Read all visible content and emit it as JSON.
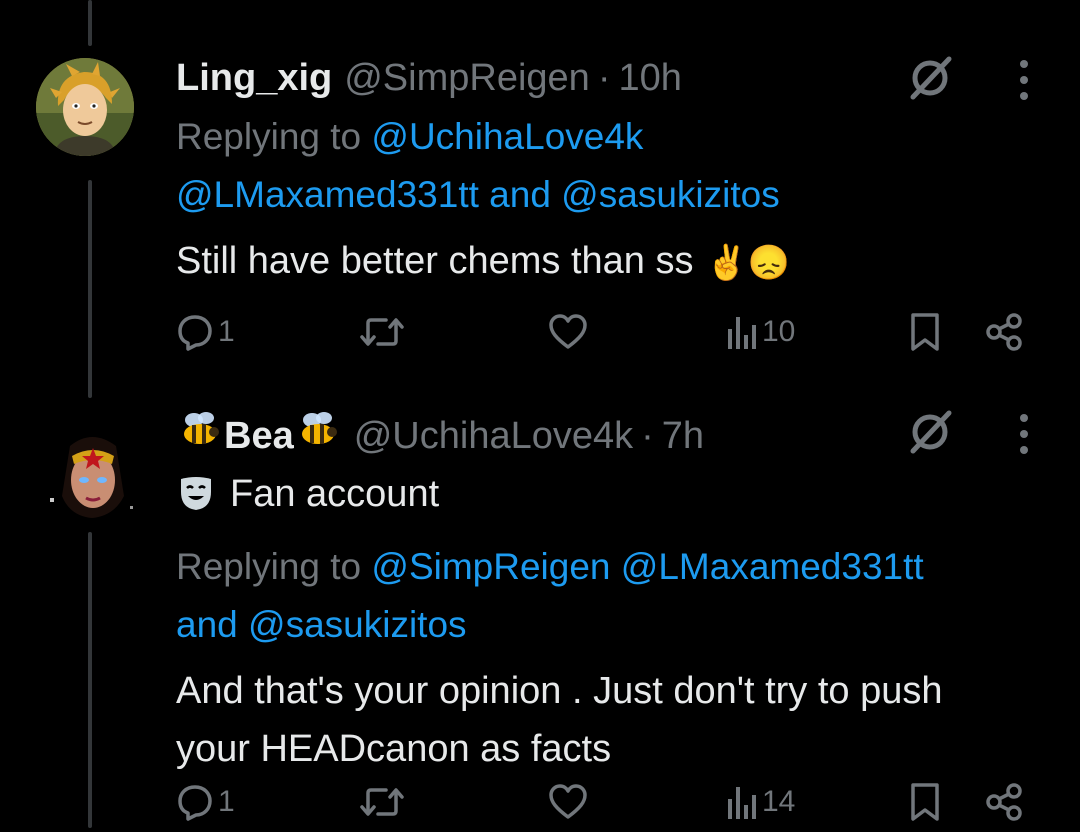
{
  "tweets": [
    {
      "display_name": "Ling_xig",
      "handle": "@SimpReigen",
      "time": "10h",
      "separator": "·",
      "replying_prefix": "Replying to",
      "replying_handles_line1": "@UchihaLove4k",
      "replying_line2": "@LMaxamed331tt and @sasukizitos",
      "body": "Still have better chems than ss",
      "emojis": "✌️😞",
      "replies": "1",
      "retweets": "",
      "likes": "",
      "views": "10",
      "avatar_icon": "anime-character-avatar"
    },
    {
      "display_name": "Bea",
      "name_decoration": "bee-emoji",
      "handle": "@UchihaLove4k",
      "time": "7h",
      "separator": "·",
      "label": "Fan account",
      "label_icon": "theater-mask-icon",
      "replying_prefix": "Replying to",
      "replying_line1_links": "@SimpReigen @LMaxamed331tt",
      "replying_line2_and": "and",
      "replying_line2_handle": "@sasukizitos",
      "body_line1": "And that's your opinion . Just don't try to push",
      "body_line2": "your HEADcanon as facts",
      "replies": "1",
      "retweets": "",
      "likes": "",
      "views": "14",
      "avatar_icon": "wonder-woman-avatar"
    }
  ],
  "colors": {
    "background": "#000000",
    "text": "#e7e9ea",
    "muted": "#71767b",
    "link": "#1d9bf0",
    "thread_line": "#333639"
  }
}
